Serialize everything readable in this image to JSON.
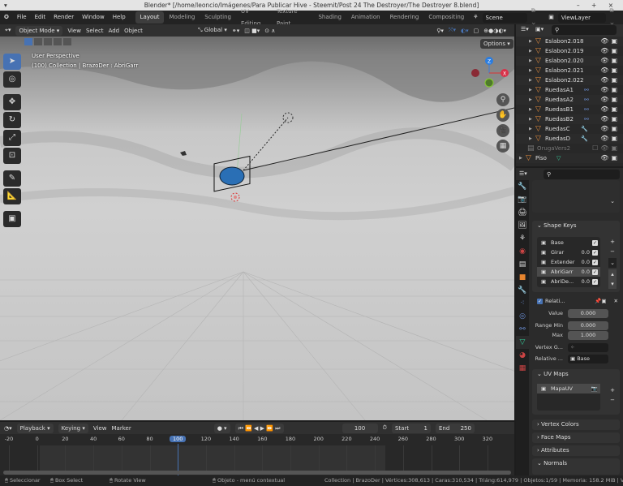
{
  "title": "Blender* [/home/leoncio/Imágenes/Para Publicar Hive - Steemit/Post 24 The Destroyer/The Destroyer 8.blend]",
  "window_controls": "– + ×",
  "menu": [
    "File",
    "Edit",
    "Render",
    "Window",
    "Help"
  ],
  "workspaces": [
    {
      "label": "Layout",
      "active": true
    },
    {
      "label": "Modeling"
    },
    {
      "label": "Sculpting"
    },
    {
      "label": "UV Editing"
    },
    {
      "label": "Texture Paint"
    },
    {
      "label": "Shading"
    },
    {
      "label": "Animation"
    },
    {
      "label": "Rendering"
    },
    {
      "label": "Compositing"
    }
  ],
  "scene": "Scene",
  "view_layer": "ViewLayer",
  "viewport_header": {
    "mode": "Object Mode",
    "menus": [
      "View",
      "Select",
      "Add",
      "Object"
    ],
    "orientation": "Global",
    "options": "Options"
  },
  "viewport": {
    "perspective": "User Perspective",
    "info": "(100) Collection | BrazoDer : AbriGarr",
    "gizmo": {
      "z": "Z",
      "x": "X"
    }
  },
  "accent": "#4772b3",
  "outliner": {
    "items": [
      {
        "name": "Eslabon2.018"
      },
      {
        "name": "Eslabon2.019"
      },
      {
        "name": "Eslabon2.020"
      },
      {
        "name": "Eslabon2.021"
      },
      {
        "name": "Eslabon2.022"
      },
      {
        "name": "RuedasA1",
        "modifier": "constraint"
      },
      {
        "name": "RuedasA2",
        "modifier": "constraint"
      },
      {
        "name": "RuedasB1",
        "modifier": "constraint"
      },
      {
        "name": "RuedasB2",
        "modifier": "constraint"
      },
      {
        "name": "RuedasC",
        "modifier": "wrench"
      },
      {
        "name": "RuedasD",
        "modifier": "wrench"
      },
      {
        "name": "OrugaVers2",
        "collection": true
      },
      {
        "name": "Piso",
        "modifier": "mesh-data"
      }
    ]
  },
  "properties": {
    "shape_keys": {
      "title": "Shape Keys",
      "keys": [
        {
          "name": "Base",
          "value": ""
        },
        {
          "name": "Girar",
          "value": "0.0"
        },
        {
          "name": "Extender",
          "value": "0.0"
        },
        {
          "name": "AbriGarr",
          "value": "0.0",
          "selected": true
        },
        {
          "name": "AbriDe...",
          "value": "0.0"
        }
      ],
      "relative_label": "Relati...",
      "value_label": "Value",
      "value": "0.000",
      "range_min_label": "Range Min",
      "range_min": "0.000",
      "max_label": "Max",
      "max": "1.000",
      "vertex_group_label": "Vertex G...",
      "relative_to_label": "Relative ...",
      "relative_to": "Base"
    },
    "uv_maps": {
      "title": "UV Maps",
      "maps": [
        "MapaUV"
      ]
    },
    "collapsed_panels": [
      "Vertex Colors",
      "Face Maps",
      "Attributes"
    ],
    "normals": "Normals"
  },
  "timeline": {
    "menus": [
      "Playback",
      "Keying",
      "View",
      "Marker"
    ],
    "current_frame": "100",
    "start_label": "Start",
    "start": "1",
    "end_label": "End",
    "end": "250",
    "ticks": [
      "-20",
      "0",
      "20",
      "40",
      "60",
      "80",
      "100",
      "120",
      "140",
      "160",
      "180",
      "200",
      "220",
      "240",
      "260",
      "280",
      "300",
      "320"
    ]
  },
  "status": {
    "select": "Seleccionar",
    "box": "Box Select",
    "rotate": "Rotate View",
    "context": "Objeto - menú contextual",
    "stats": "Collection | BrazoDer | Vértices:308,613 | Caras:310,534 | Triáng:614,979 | Objetos:1/59 | Memoria: 158.2 MiB | VRAM: 0"
  }
}
